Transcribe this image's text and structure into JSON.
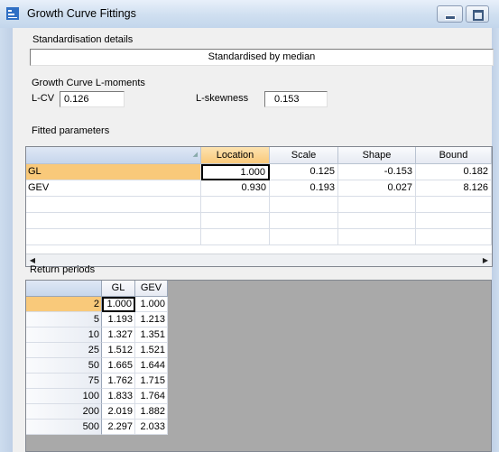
{
  "window": {
    "title": "Growth Curve Fittings"
  },
  "standardisation": {
    "section_label": "Standardisation details",
    "method": "Standardised by median"
  },
  "lmoments": {
    "section_label": "Growth Curve L-moments",
    "lcv_label": "L-CV",
    "lcv_value": "0.126",
    "lskew_label": "L-skewness",
    "lskew_value": "0.153"
  },
  "fitted": {
    "section_label": "Fitted parameters",
    "columns": [
      "Location",
      "Scale",
      "Shape",
      "Bound"
    ],
    "rows": [
      {
        "name": "GL",
        "values": [
          "1.000",
          "0.125",
          "-0.153",
          "0.182"
        ]
      },
      {
        "name": "GEV",
        "values": [
          "0.930",
          "0.193",
          "0.027",
          "8.126"
        ]
      }
    ]
  },
  "return_periods": {
    "section_label": "Return periods",
    "columns": [
      "GL",
      "GEV"
    ],
    "rows": [
      {
        "period": "2",
        "values": [
          "1.000",
          "1.000"
        ]
      },
      {
        "period": "5",
        "values": [
          "1.193",
          "1.213"
        ]
      },
      {
        "period": "10",
        "values": [
          "1.327",
          "1.351"
        ]
      },
      {
        "period": "25",
        "values": [
          "1.512",
          "1.521"
        ]
      },
      {
        "period": "50",
        "values": [
          "1.665",
          "1.644"
        ]
      },
      {
        "period": "75",
        "values": [
          "1.762",
          "1.715"
        ]
      },
      {
        "period": "100",
        "values": [
          "1.833",
          "1.764"
        ]
      },
      {
        "period": "200",
        "values": [
          "2.019",
          "1.882"
        ]
      },
      {
        "period": "500",
        "values": [
          "2.297",
          "2.033"
        ]
      }
    ]
  },
  "colors": {
    "selection": "#f9c97a",
    "grid_empty": "#a9a9a9"
  }
}
